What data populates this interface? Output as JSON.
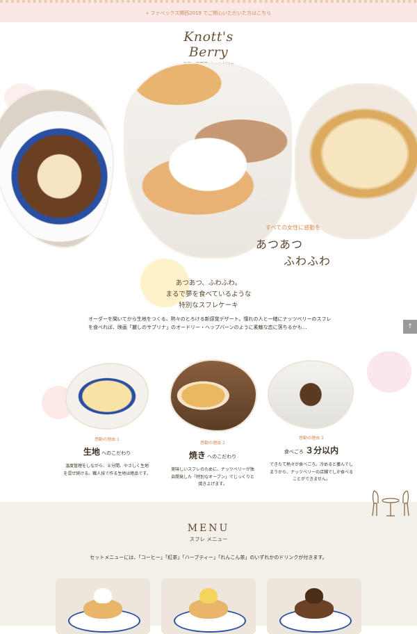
{
  "banner": {
    "link": "» ファベックス関西2019 でご関心いただいた方はこちら"
  },
  "logo": {
    "name": "Knott's Berry",
    "subtitle": "スフレ専門店 ナッツベリー"
  },
  "hero": {
    "pretitle": "すべての女性に感動を",
    "title_line1": "あつあつ",
    "title_line2": "ふわふわ",
    "intro": [
      "あつあつ、ふわふわ。",
      "まるで夢を食べているような",
      "特別なスフレケーキ"
    ],
    "body": "オーダーを聞いてから生地をつくる、熱々のとろける新感覚デザート。憧れの人と一緒にナッツベリーのスフレを食べれば、映画「麗しのサブリナ」のオードリー・ヘップバーンのように素敵な恋に落ちるかも…"
  },
  "to_top": {
    "icon": "arrow-up-icon",
    "label": "↑"
  },
  "reasons": [
    {
      "label": "感動の理由 1",
      "title_main": "生地",
      "title_rest": " へのこだわり",
      "text": [
        "温度管理をしながら、８分間、やさしく生地",
        "を混ぜ続ける。職人技で作る生地は絶品です。"
      ]
    },
    {
      "label": "感動の理由 2",
      "title_main": "焼き",
      "title_rest": " へのこだわり",
      "text": [
        "美味しいスフレのために、ナッツベリーが独",
        "自開発した「特別なオーブン」でじっくりと",
        "焼き上げます。"
      ]
    },
    {
      "label": "感動の理由 3",
      "title_main": "３分以内",
      "title_pre": "食べごろ ",
      "text": [
        "できたて熱々が食べごろ。冷めると萎んでし",
        "まうから、ナッツベリーの店舗でしか食べる",
        "ことができません。"
      ]
    }
  ],
  "menu": {
    "heading": "MENU",
    "subheading": "スフレ メニュー",
    "note": "セットメニューには、「コーヒー」「紅茶」「ハーブティー」「れんこん茶」のいずれかのドリンクが付きます。"
  }
}
